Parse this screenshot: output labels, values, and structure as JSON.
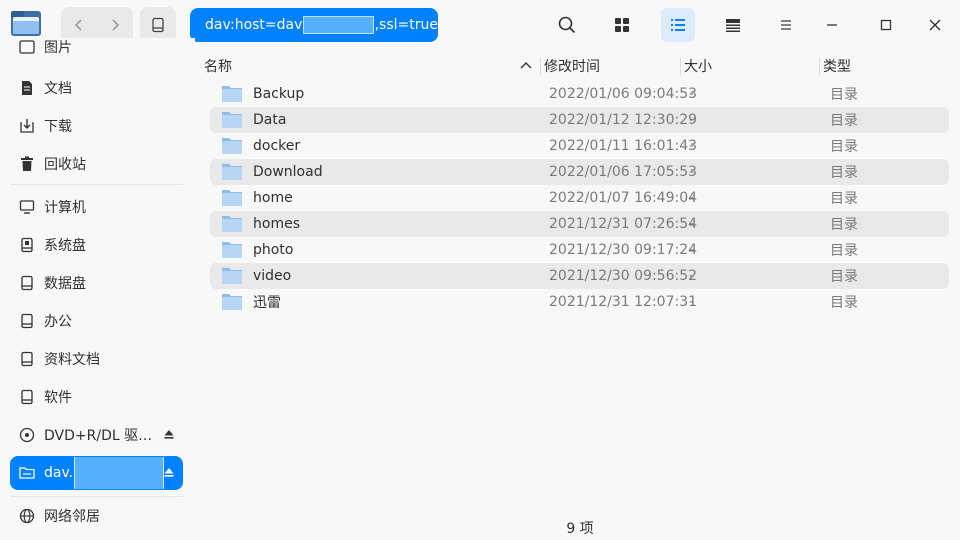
{
  "address": {
    "prefix": "dav:host=dav",
    "suffix": ",ssl=true"
  },
  "sidebar": {
    "items": [
      {
        "label": "图片",
        "icon": "picture-icon"
      },
      {
        "label": "文档",
        "icon": "document-icon"
      },
      {
        "label": "下载",
        "icon": "download-icon"
      },
      {
        "label": "回收站",
        "icon": "trash-icon"
      },
      {
        "label": "计算机",
        "icon": "computer-icon"
      },
      {
        "label": "系统盘",
        "icon": "system-disk-icon"
      },
      {
        "label": "数据盘",
        "icon": "disk-icon"
      },
      {
        "label": "办公",
        "icon": "disk-icon"
      },
      {
        "label": "资料文档",
        "icon": "disk-icon"
      },
      {
        "label": "软件",
        "icon": "disk-icon"
      },
      {
        "label": "DVD+R/DL 驱…",
        "icon": "optical-drive-icon"
      },
      {
        "label": "dav.",
        "icon": "network-drive-icon"
      },
      {
        "label": "网络邻居",
        "icon": "network-icon"
      }
    ]
  },
  "table": {
    "headers": {
      "name": "名称",
      "modified": "修改时间",
      "size": "大小",
      "type": "类型"
    },
    "rows": [
      {
        "name": "Backup",
        "modified": "2022/01/06 09:04:53",
        "size": "-",
        "type": "目录"
      },
      {
        "name": "Data",
        "modified": "2022/01/12 12:30:29",
        "size": "-",
        "type": "目录"
      },
      {
        "name": "docker",
        "modified": "2022/01/11 16:01:43",
        "size": "-",
        "type": "目录"
      },
      {
        "name": "Download",
        "modified": "2022/01/06 17:05:53",
        "size": "-",
        "type": "目录"
      },
      {
        "name": "home",
        "modified": "2022/01/07 16:49:04",
        "size": "-",
        "type": "目录"
      },
      {
        "name": "homes",
        "modified": "2021/12/31 07:26:54",
        "size": "-",
        "type": "目录"
      },
      {
        "name": "photo",
        "modified": "2021/12/30 09:17:24",
        "size": "-",
        "type": "目录"
      },
      {
        "name": "video",
        "modified": "2021/12/30 09:56:52",
        "size": "-",
        "type": "目录"
      },
      {
        "name": "迅雷",
        "modified": "2021/12/31 12:07:31",
        "size": "-",
        "type": "目录"
      }
    ]
  },
  "status": {
    "count": "9 项"
  },
  "colors": {
    "accent": "#0081ff",
    "row_alt": "#e9e9e9",
    "folder": "#a9cdf2"
  }
}
